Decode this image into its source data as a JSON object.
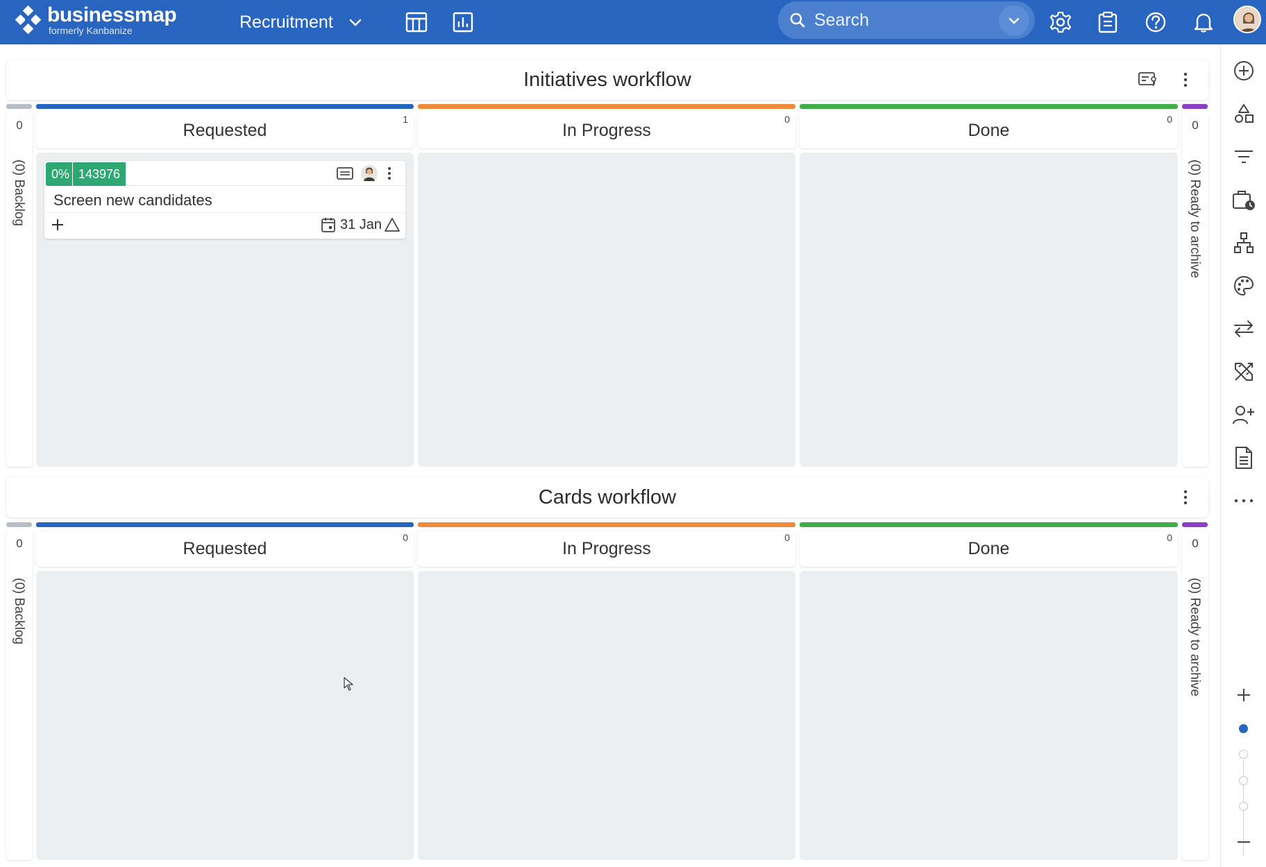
{
  "app": {
    "logo_name": "businessmap",
    "logo_sub": "formerly Kanbanize",
    "board_name": "Recruitment"
  },
  "search": {
    "placeholder": "Search"
  },
  "top_icons": [
    "table-view-icon",
    "analytics-icon",
    "settings-icon",
    "clipboard-icon",
    "help-icon",
    "bell-icon"
  ],
  "sidebar": {
    "items": [
      "add-icon",
      "shapes-icon",
      "filter-icon",
      "time-icon",
      "hierarchy-icon",
      "palette-icon",
      "swap-icon",
      "tools-icon",
      "add-user-icon",
      "document-icon",
      "more-icon"
    ],
    "zoom_levels": 4,
    "zoom_active": 1
  },
  "workflows": [
    {
      "title": "Initiatives workflow",
      "backlog_count": "0",
      "backlog_label": "(0) Backlog",
      "archive_count": "0",
      "archive_label": "(0) Ready to archive",
      "columns": [
        {
          "name": "Requested",
          "count": "1",
          "color": "#2865c1"
        },
        {
          "name": "In Progress",
          "count": "0",
          "color": "#ef8b3a"
        },
        {
          "name": "Done",
          "count": "0",
          "color": "#3fae49"
        }
      ]
    },
    {
      "title": "Cards workflow",
      "backlog_count": "0",
      "backlog_label": "(0) Backlog",
      "archive_count": "0",
      "archive_label": "(0) Ready to archive",
      "columns": [
        {
          "name": "Requested",
          "count": "0",
          "color": "#2865c1"
        },
        {
          "name": "In Progress",
          "count": "0",
          "color": "#ef8b3a"
        },
        {
          "name": "Done",
          "count": "0",
          "color": "#3fae49"
        }
      ]
    }
  ],
  "card": {
    "progress": "0%",
    "id": "143976",
    "title": "Screen new candidates",
    "due_date": "31 Jan",
    "tag_color": "#2ea873"
  },
  "colors": {
    "topbar": "#2865c1",
    "backlog_bar": "#b8bec6",
    "archive_bar": "#8a3fc6"
  }
}
